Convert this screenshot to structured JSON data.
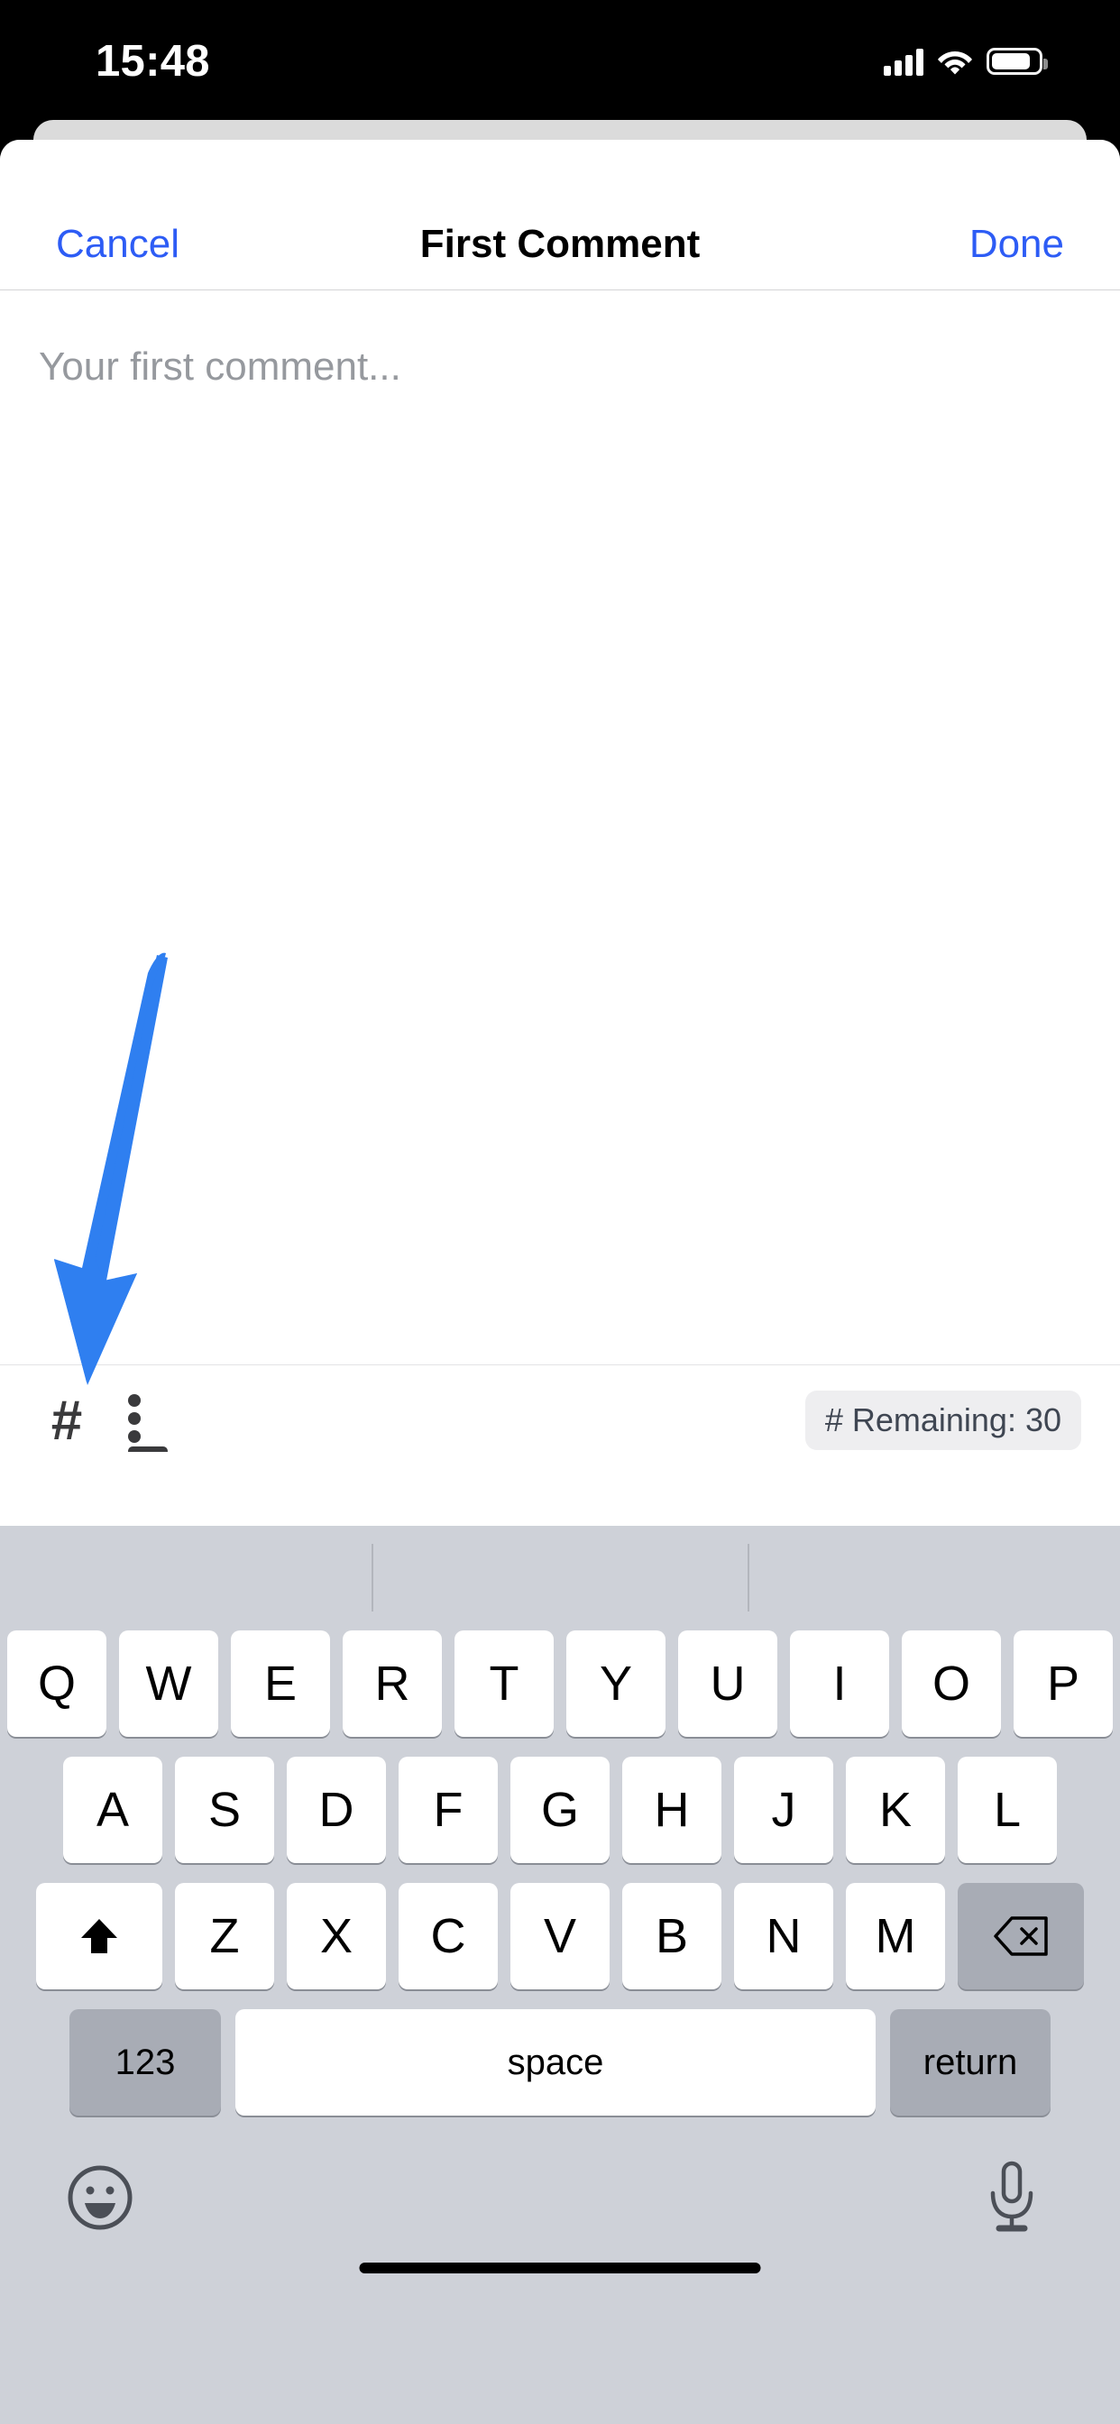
{
  "status_bar": {
    "time": "15:48",
    "cellular_icon": "cellular-bars-icon",
    "wifi_icon": "wifi-icon",
    "battery_icon": "battery-icon"
  },
  "nav_bar": {
    "cancel_label": "Cancel",
    "title": "First Comment",
    "done_label": "Done"
  },
  "comment_editor": {
    "value": "",
    "placeholder": "Your first comment..."
  },
  "input_toolbar": {
    "hashtag_icon": "#",
    "format_icon": "text-format-icon",
    "remaining_badge": "# Remaining: 30"
  },
  "annotation": {
    "arrow_color": "#2f7ff0",
    "points_to": "hashtag-button"
  },
  "keyboard": {
    "rows": [
      [
        "Q",
        "W",
        "E",
        "R",
        "T",
        "Y",
        "U",
        "I",
        "O",
        "P"
      ],
      [
        "A",
        "S",
        "D",
        "F",
        "G",
        "H",
        "J",
        "K",
        "L"
      ],
      [
        "Z",
        "X",
        "C",
        "V",
        "B",
        "N",
        "M"
      ]
    ],
    "shift_icon": "shift-arrow-icon",
    "backspace_icon": "backspace-icon",
    "numeric_label": "123",
    "space_label": "space",
    "return_label": "return",
    "emoji_icon": "emoji-smiley-icon",
    "dictation_icon": "microphone-icon"
  },
  "colors": {
    "accent_blue": "#2d5cf5",
    "annotation_blue": "#2f7ff0",
    "keyboard_bg": "#ced1d8",
    "key_white": "#ffffff",
    "key_gray": "#a8acb5",
    "badge_bg": "#eeeef0",
    "placeholder_gray": "#96999e",
    "back_card_gray": "#dbdbdb"
  }
}
